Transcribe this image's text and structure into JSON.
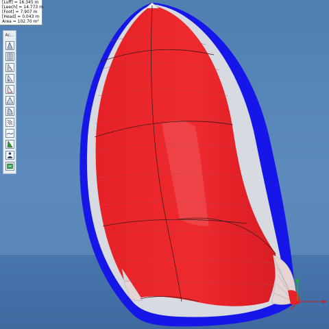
{
  "info_panel": {
    "luff": "[Luff] = 16.345 m",
    "leech": "[Leech] = 14.773 m",
    "foot": "[Foot] = 7.907 m",
    "head": "[Head] = 0.043 m",
    "area": "Area = 102.70 m²"
  },
  "toolbar": {
    "title": "Ac...",
    "tools": [
      {
        "icon": "sail-outline-icon"
      },
      {
        "icon": "sail-panels-icon"
      },
      {
        "icon": "sail-seams-icon"
      },
      {
        "icon": "sail-patch-icon"
      },
      {
        "icon": "sail-measure-icon"
      },
      {
        "icon": "sail-triangle-icon"
      },
      {
        "icon": "sail-shape-icon"
      },
      {
        "icon": "sail-wind-icon"
      },
      {
        "icon": "sail-curve-icon"
      },
      {
        "icon": "sail-color-icon"
      },
      {
        "icon": "sail-person-icon"
      },
      {
        "icon": "sail-export-icon"
      }
    ]
  },
  "colors": {
    "sky": "#5b88b7",
    "sail_red": "#e8222a",
    "sail_white": "#d9dde3",
    "sail_blue": "#1a1ae6"
  }
}
